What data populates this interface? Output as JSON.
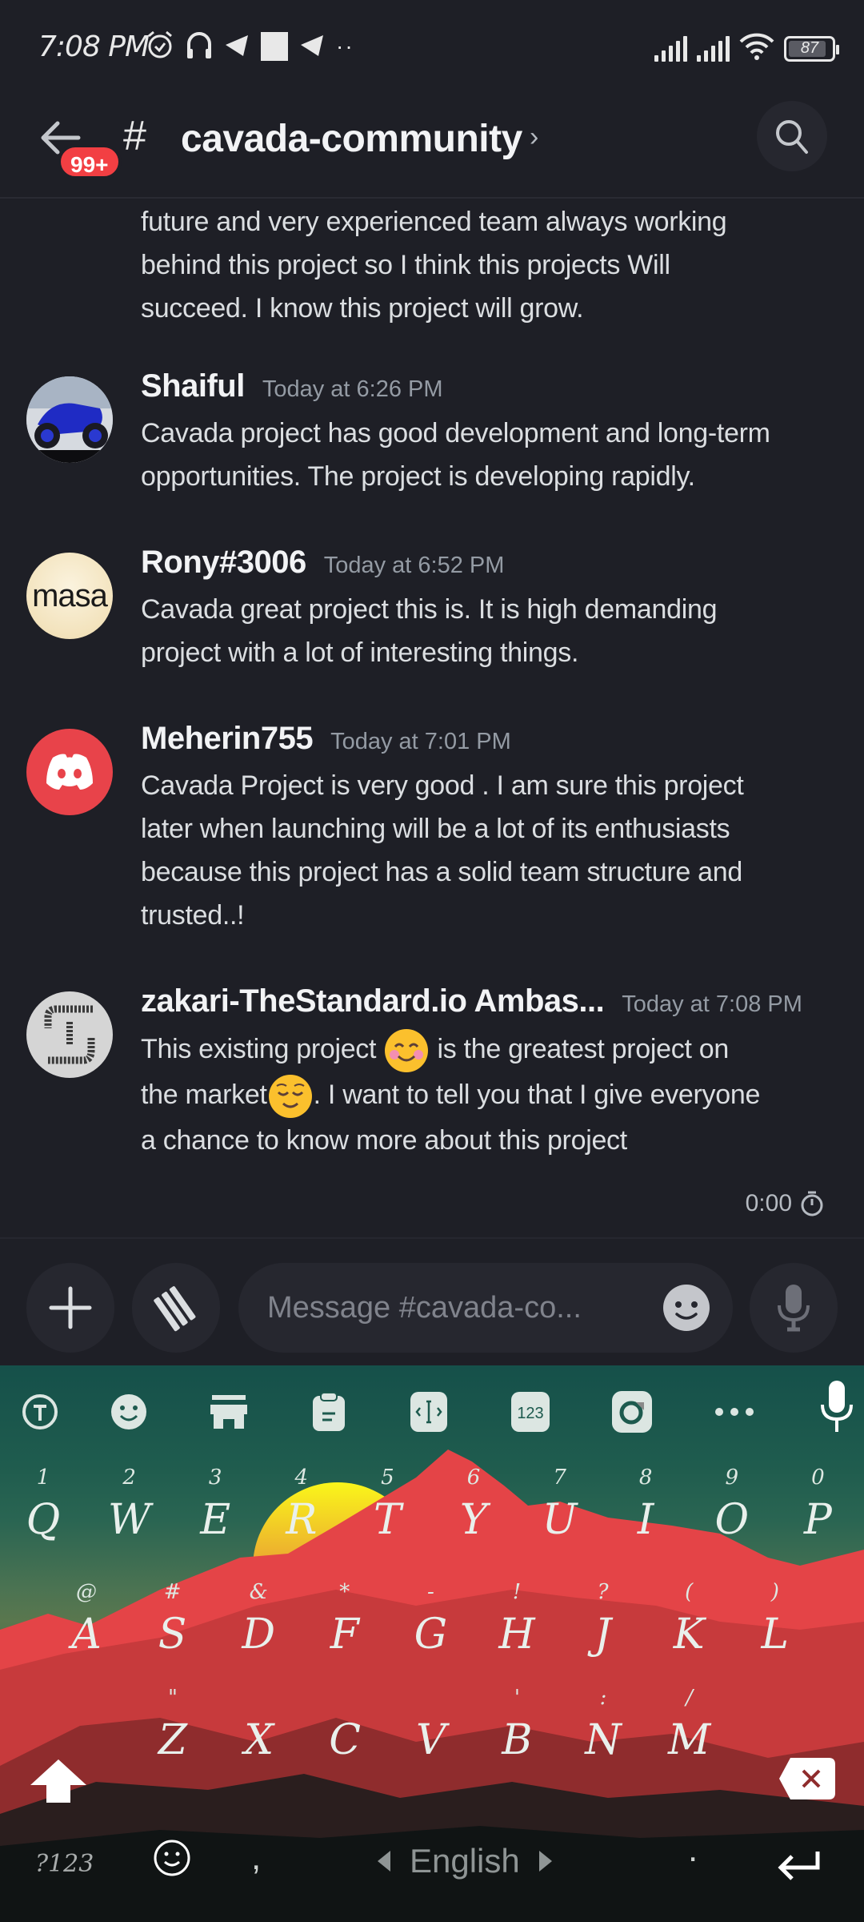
{
  "status_bar": {
    "time": "7:08 PM",
    "left_icons": [
      "alarm-icon",
      "headphones-icon",
      "telegram-icon",
      "square-notification-icon",
      "telegram-icon",
      "more-dots-icon"
    ],
    "battery_level": "87",
    "right_icons": [
      "signal-icon",
      "signal-icon",
      "wifi-icon",
      "battery-icon"
    ]
  },
  "header": {
    "back_label": "Back",
    "unread_badge": "99+",
    "channel_hash": "#",
    "channel_name": "cavada-community",
    "chevron": "›",
    "search_label": "Search"
  },
  "messages": {
    "continuation": "future and very experienced team always working behind this project so I think this projects Will succeed. I know this project will grow.",
    "continuation_lines": [
      "future and very experienced team always working",
      "behind this project so I think this projects Will",
      "succeed. I know this project will grow."
    ],
    "items": [
      {
        "username": "Shaiful",
        "timestamp": "Today at 6:26 PM",
        "avatar": "motorcycle-avatar",
        "lines": [
          "Cavada project has good development and long-term",
          "opportunities. The project is developing rapidly."
        ]
      },
      {
        "username": "Rony#3006",
        "timestamp": "Today at 6:52 PM",
        "avatar": "masa-avatar",
        "avatar_text": "masa",
        "lines": [
          "Cavada great project this is. It is high demanding",
          "project with a lot of interesting things."
        ]
      },
      {
        "username": "Meherin755",
        "timestamp": "Today at 7:01 PM",
        "avatar": "discord-default-avatar",
        "lines": [
          "Cavada Project is very good . I am sure this project",
          "later when launching will be a lot of its enthusiasts",
          "because this project has a solid team structure and",
          "trusted..!"
        ]
      },
      {
        "username": "zakari-TheStandard.io Ambas...",
        "timestamp": "Today at 7:08 PM",
        "avatar": "thestandard-avatar",
        "line1_a": "This existing project ",
        "line1_emoji": "😊",
        "line1_b": " is the greatest project on",
        "line2_a": "the market",
        "line2_emoji": "😌",
        "line2_b": ".  I want to tell you that I give everyone",
        "line3": "a chance to know more about this project"
      }
    ]
  },
  "timer": {
    "value": "0:00"
  },
  "composer": {
    "placeholder": "Message #cavada-co...",
    "value": "",
    "add_label": "+",
    "apps_label": "Apps",
    "emoji_label": "Emoji",
    "voice_label": "Voice"
  },
  "keyboard": {
    "toolbar": [
      "translate-icon",
      "emoji-icon",
      "store-icon",
      "clipboard-icon",
      "text-edit-icon",
      "numpad-icon",
      "grammarly-icon",
      "more-icon",
      "mic-icon"
    ],
    "row1": [
      {
        "key": "Q",
        "hint": "1"
      },
      {
        "key": "W",
        "hint": "2"
      },
      {
        "key": "E",
        "hint": "3"
      },
      {
        "key": "R",
        "hint": "4"
      },
      {
        "key": "T",
        "hint": "5"
      },
      {
        "key": "Y",
        "hint": "6"
      },
      {
        "key": "U",
        "hint": "7"
      },
      {
        "key": "I",
        "hint": "8"
      },
      {
        "key": "O",
        "hint": "9"
      },
      {
        "key": "P",
        "hint": "0"
      }
    ],
    "row2": [
      {
        "key": "A",
        "hint": "@"
      },
      {
        "key": "S",
        "hint": "#"
      },
      {
        "key": "D",
        "hint": "&"
      },
      {
        "key": "F",
        "hint": "*"
      },
      {
        "key": "G",
        "hint": "-"
      },
      {
        "key": "H",
        "hint": "!"
      },
      {
        "key": "J",
        "hint": "?"
      },
      {
        "key": "K",
        "hint": "("
      },
      {
        "key": "L",
        "hint": ")"
      }
    ],
    "row3": [
      {
        "key": "Z",
        "hint": "\""
      },
      {
        "key": "X",
        "hint": ""
      },
      {
        "key": "C",
        "hint": ""
      },
      {
        "key": "V",
        "hint": ""
      },
      {
        "key": "B",
        "hint": "'"
      },
      {
        "key": "N",
        "hint": ":"
      },
      {
        "key": "M",
        "hint": "/"
      }
    ],
    "symbols_label": "?123",
    "comma": ",",
    "period": ".",
    "language": "English",
    "colors": {
      "sky_top": "#15504a",
      "sun": "#f7e21a",
      "mountain": "#e44447",
      "ground": "#101414"
    }
  },
  "colors": {
    "background": "#1e1f26",
    "badge": "#f23f43",
    "discord_red_avatar": "#e8434a",
    "input_bg": "#26272f"
  }
}
